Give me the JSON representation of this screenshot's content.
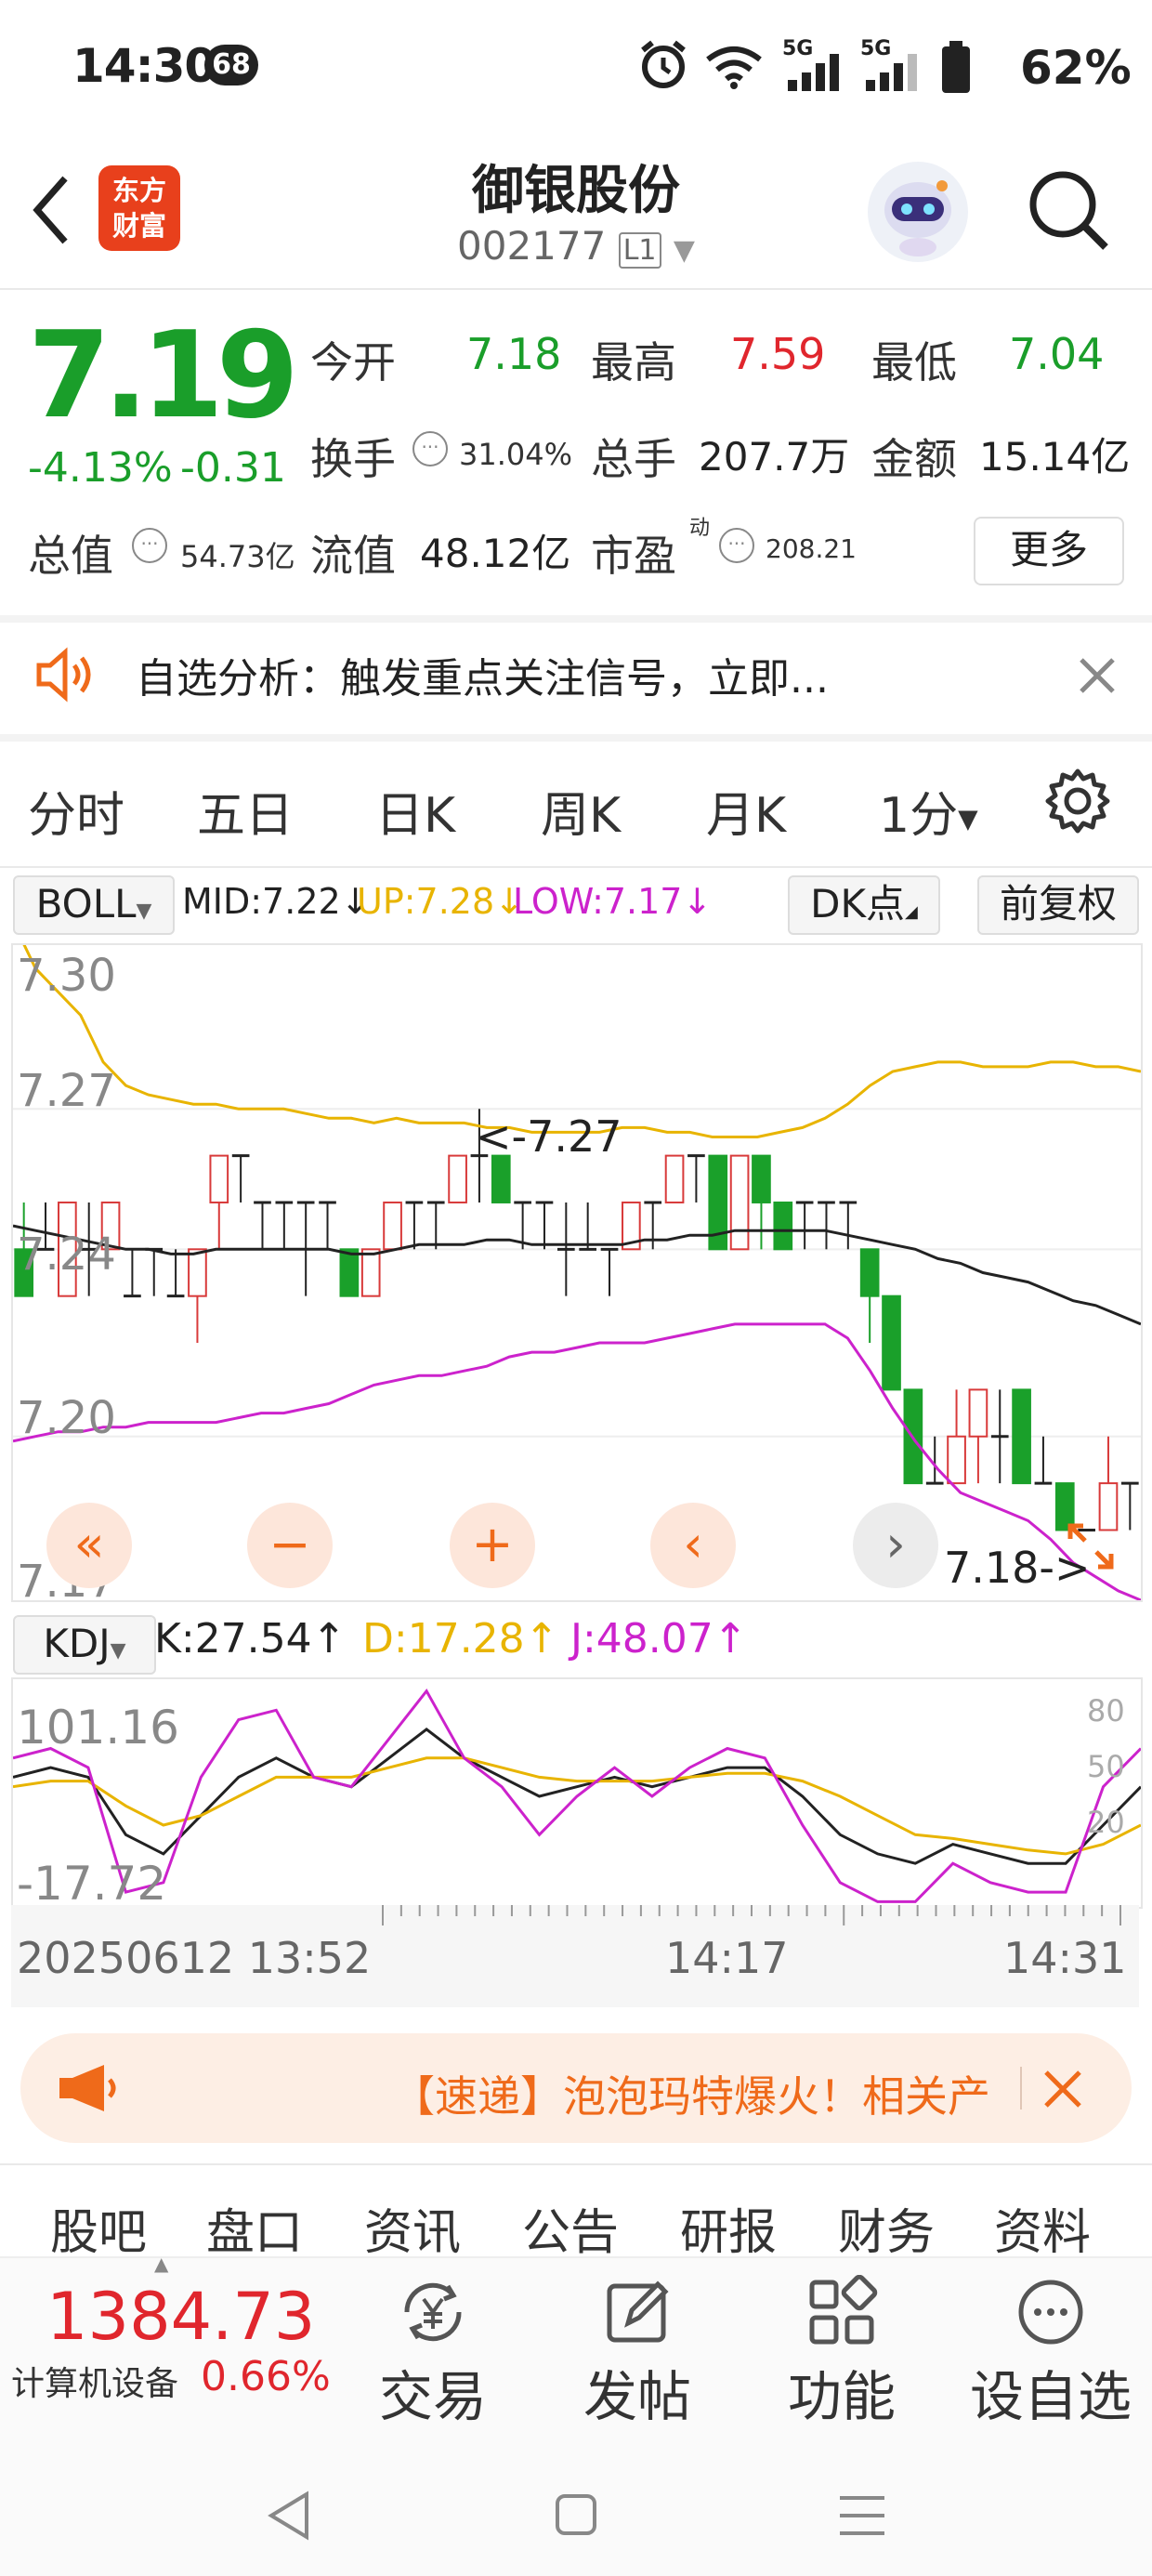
{
  "status": {
    "time": "14:30",
    "badge": "68",
    "battery": "62%",
    "net1": "5G",
    "net2": "5G"
  },
  "header": {
    "title": "御银股份",
    "code": "002177",
    "level_badge": "L1",
    "logo_text_1": "东方",
    "logo_text_2": "财富"
  },
  "quote": {
    "price": "7.19",
    "change_pct": "-4.13%",
    "change": "-0.31",
    "open_label": "今开",
    "open": "7.18",
    "high_label": "最高",
    "high": "7.59",
    "low_label": "最低",
    "low": "7.04",
    "turnover_label": "换手",
    "turnover": "31.04%",
    "volume_label": "总手",
    "volume": "207.7万",
    "amount_label": "金额",
    "amount": "15.14亿",
    "mktcap_label": "总值",
    "mktcap": "54.73亿",
    "float_label": "流值",
    "float": "48.12亿",
    "pe_label": "市盈",
    "pe_sup": "动",
    "pe": "208.21",
    "more": "更多"
  },
  "notice": {
    "text": "自选分析：触发重点关注信号，立即..."
  },
  "tabs": [
    "分时",
    "五日",
    "日K",
    "周K",
    "月K",
    "1分"
  ],
  "boll": {
    "name": "BOLL",
    "mid": "MID:7.22↓",
    "up": "UP:7.28↓",
    "low": "LOW:7.17↓",
    "dk_button": "DK点",
    "adjust_button": "前复权",
    "colors": {
      "mid": "#222222",
      "up": "#e8b400",
      "low": "#cc22cc"
    },
    "y_labels": [
      "7.30",
      "7.27",
      "7.24",
      "7.20",
      "7.17"
    ],
    "max_marker": "<-7.27",
    "min_marker": "7.18->"
  },
  "kdj": {
    "name": "KDJ",
    "k": "K:27.54↑",
    "d": "D:17.28↑",
    "j": "J:48.07↑",
    "y_top": "101.16",
    "y_bottom": "-17.72",
    "right_labels": [
      "80",
      "50",
      "20"
    ]
  },
  "time_axis": {
    "start": "20250612 13:52",
    "mid": "14:17",
    "end": "14:31"
  },
  "news": {
    "text": "【速递】泡泡玛特爆火！相关产"
  },
  "bottom_tabs": [
    "股吧",
    "盘口",
    "资讯",
    "公告",
    "研报",
    "财务",
    "资料"
  ],
  "toolbar": {
    "index_value": "1384.73",
    "index_name": "计算机设备",
    "index_pct": "0.66%",
    "buttons": [
      "交易",
      "发帖",
      "功能",
      "设自选"
    ]
  },
  "chart_data": [
    {
      "type": "candlestick",
      "title": "BOLL",
      "ylim": [
        7.165,
        7.305
      ],
      "candles": [
        {
          "o": 7.24,
          "c": 7.23,
          "h": 7.25,
          "l": 7.23
        },
        {
          "o": 7.24,
          "c": 7.24,
          "h": 7.25,
          "l": 7.24
        },
        {
          "o": 7.23,
          "c": 7.25,
          "h": 7.25,
          "l": 7.23
        },
        {
          "o": 7.24,
          "c": 7.24,
          "h": 7.25,
          "l": 7.23
        },
        {
          "o": 7.24,
          "c": 7.25,
          "h": 7.25,
          "l": 7.24
        },
        {
          "o": 7.23,
          "c": 7.23,
          "h": 7.24,
          "l": 7.23
        },
        {
          "o": 7.24,
          "c": 7.24,
          "h": 7.24,
          "l": 7.23
        },
        {
          "o": 7.23,
          "c": 7.23,
          "h": 7.24,
          "l": 7.23
        },
        {
          "o": 7.23,
          "c": 7.24,
          "h": 7.24,
          "l": 7.22
        },
        {
          "o": 7.25,
          "c": 7.26,
          "h": 7.26,
          "l": 7.24
        },
        {
          "o": 7.26,
          "c": 7.26,
          "h": 7.26,
          "l": 7.25
        },
        {
          "o": 7.25,
          "c": 7.25,
          "h": 7.25,
          "l": 7.24
        },
        {
          "o": 7.25,
          "c": 7.25,
          "h": 7.25,
          "l": 7.24
        },
        {
          "o": 7.25,
          "c": 7.25,
          "h": 7.25,
          "l": 7.23
        },
        {
          "o": 7.25,
          "c": 7.25,
          "h": 7.25,
          "l": 7.24
        },
        {
          "o": 7.24,
          "c": 7.23,
          "h": 7.24,
          "l": 7.23
        },
        {
          "o": 7.23,
          "c": 7.24,
          "h": 7.24,
          "l": 7.23
        },
        {
          "o": 7.24,
          "c": 7.25,
          "h": 7.25,
          "l": 7.24
        },
        {
          "o": 7.25,
          "c": 7.25,
          "h": 7.25,
          "l": 7.24
        },
        {
          "o": 7.25,
          "c": 7.25,
          "h": 7.25,
          "l": 7.24
        },
        {
          "o": 7.25,
          "c": 7.26,
          "h": 7.26,
          "l": 7.25
        },
        {
          "o": 7.26,
          "c": 7.26,
          "h": 7.27,
          "l": 7.25
        },
        {
          "o": 7.26,
          "c": 7.25,
          "h": 7.26,
          "l": 7.25
        },
        {
          "o": 7.25,
          "c": 7.25,
          "h": 7.25,
          "l": 7.24
        },
        {
          "o": 7.25,
          "c": 7.25,
          "h": 7.25,
          "l": 7.24
        },
        {
          "o": 7.24,
          "c": 7.24,
          "h": 7.25,
          "l": 7.23
        },
        {
          "o": 7.24,
          "c": 7.24,
          "h": 7.25,
          "l": 7.24
        },
        {
          "o": 7.24,
          "c": 7.24,
          "h": 7.24,
          "l": 7.23
        },
        {
          "o": 7.24,
          "c": 7.25,
          "h": 7.25,
          "l": 7.24
        },
        {
          "o": 7.25,
          "c": 7.25,
          "h": 7.25,
          "l": 7.24
        },
        {
          "o": 7.25,
          "c": 7.26,
          "h": 7.26,
          "l": 7.25
        },
        {
          "o": 7.26,
          "c": 7.26,
          "h": 7.26,
          "l": 7.25
        },
        {
          "o": 7.26,
          "c": 7.24,
          "h": 7.26,
          "l": 7.24
        },
        {
          "o": 7.24,
          "c": 7.26,
          "h": 7.26,
          "l": 7.24
        },
        {
          "o": 7.26,
          "c": 7.25,
          "h": 7.26,
          "l": 7.24
        },
        {
          "o": 7.25,
          "c": 7.24,
          "h": 7.25,
          "l": 7.24
        },
        {
          "o": 7.25,
          "c": 7.25,
          "h": 7.25,
          "l": 7.24
        },
        {
          "o": 7.25,
          "c": 7.25,
          "h": 7.25,
          "l": 7.24
        },
        {
          "o": 7.25,
          "c": 7.25,
          "h": 7.25,
          "l": 7.24
        },
        {
          "o": 7.24,
          "c": 7.23,
          "h": 7.24,
          "l": 7.22
        },
        {
          "o": 7.23,
          "c": 7.21,
          "h": 7.23,
          "l": 7.21
        },
        {
          "o": 7.21,
          "c": 7.19,
          "h": 7.21,
          "l": 7.19
        },
        {
          "o": 7.19,
          "c": 7.19,
          "h": 7.2,
          "l": 7.19
        },
        {
          "o": 7.19,
          "c": 7.2,
          "h": 7.21,
          "l": 7.19
        },
        {
          "o": 7.2,
          "c": 7.21,
          "h": 7.21,
          "l": 7.19
        },
        {
          "o": 7.2,
          "c": 7.2,
          "h": 7.21,
          "l": 7.19
        },
        {
          "o": 7.21,
          "c": 7.19,
          "h": 7.21,
          "l": 7.19
        },
        {
          "o": 7.19,
          "c": 7.19,
          "h": 7.2,
          "l": 7.19
        },
        {
          "o": 7.19,
          "c": 7.18,
          "h": 7.19,
          "l": 7.18
        },
        {
          "o": 7.18,
          "c": 7.18,
          "h": 7.18,
          "l": 7.18
        },
        {
          "o": 7.18,
          "c": 7.19,
          "h": 7.2,
          "l": 7.18
        },
        {
          "o": 7.19,
          "c": 7.19,
          "h": 7.19,
          "l": 7.18
        }
      ],
      "series": [
        {
          "name": "UP",
          "values": [
            7.31,
            7.3,
            7.295,
            7.29,
            7.28,
            7.275,
            7.273,
            7.272,
            7.271,
            7.271,
            7.27,
            7.27,
            7.27,
            7.269,
            7.268,
            7.268,
            7.267,
            7.268,
            7.267,
            7.267,
            7.267,
            7.266,
            7.266,
            7.265,
            7.265,
            7.265,
            7.265,
            7.266,
            7.266,
            7.265,
            7.265,
            7.264,
            7.264,
            7.264,
            7.265,
            7.266,
            7.268,
            7.271,
            7.275,
            7.278,
            7.279,
            7.28,
            7.28,
            7.279,
            7.279,
            7.279,
            7.28,
            7.28,
            7.279,
            7.279,
            7.278
          ]
        },
        {
          "name": "MID",
          "values": [
            7.245,
            7.244,
            7.243,
            7.242,
            7.241,
            7.24,
            7.24,
            7.239,
            7.239,
            7.24,
            7.24,
            7.24,
            7.24,
            7.24,
            7.24,
            7.239,
            7.239,
            7.24,
            7.241,
            7.241,
            7.241,
            7.242,
            7.242,
            7.241,
            7.241,
            7.241,
            7.241,
            7.241,
            7.242,
            7.242,
            7.243,
            7.243,
            7.244,
            7.244,
            7.244,
            7.244,
            7.244,
            7.243,
            7.242,
            7.241,
            7.24,
            7.238,
            7.237,
            7.235,
            7.234,
            7.233,
            7.231,
            7.229,
            7.228,
            7.226,
            7.224
          ]
        },
        {
          "name": "LOW",
          "values": [
            7.199,
            7.2,
            7.201,
            7.201,
            7.202,
            7.202,
            7.203,
            7.203,
            7.203,
            7.203,
            7.204,
            7.205,
            7.205,
            7.206,
            7.207,
            7.209,
            7.211,
            7.212,
            7.213,
            7.213,
            7.214,
            7.215,
            7.217,
            7.218,
            7.218,
            7.219,
            7.22,
            7.22,
            7.22,
            7.221,
            7.222,
            7.223,
            7.224,
            7.224,
            7.224,
            7.224,
            7.224,
            7.221,
            7.214,
            7.206,
            7.199,
            7.193,
            7.188,
            7.186,
            7.184,
            7.182,
            7.178,
            7.173,
            7.17,
            7.167,
            7.165
          ]
        }
      ]
    },
    {
      "type": "line",
      "title": "KDJ",
      "ylim": [
        -17.72,
        101.16
      ],
      "series": [
        {
          "name": "K",
          "values": [
            50,
            55,
            50,
            20,
            10,
            30,
            50,
            60,
            50,
            45,
            60,
            75,
            60,
            50,
            40,
            45,
            50,
            45,
            50,
            55,
            55,
            40,
            20,
            10,
            5,
            15,
            10,
            5,
            5,
            25,
            45
          ]
        },
        {
          "name": "D",
          "values": [
            45,
            48,
            48,
            35,
            25,
            30,
            40,
            50,
            50,
            50,
            55,
            60,
            60,
            55,
            50,
            48,
            48,
            48,
            50,
            52,
            52,
            48,
            40,
            30,
            20,
            18,
            15,
            12,
            10,
            15,
            25
          ]
        },
        {
          "name": "J",
          "values": [
            60,
            65,
            55,
            -10,
            -5,
            50,
            80,
            85,
            50,
            45,
            70,
            95,
            60,
            45,
            20,
            40,
            55,
            40,
            55,
            65,
            60,
            25,
            -5,
            -15,
            -15,
            5,
            -5,
            -10,
            -10,
            45,
            65
          ]
        }
      ]
    }
  ]
}
